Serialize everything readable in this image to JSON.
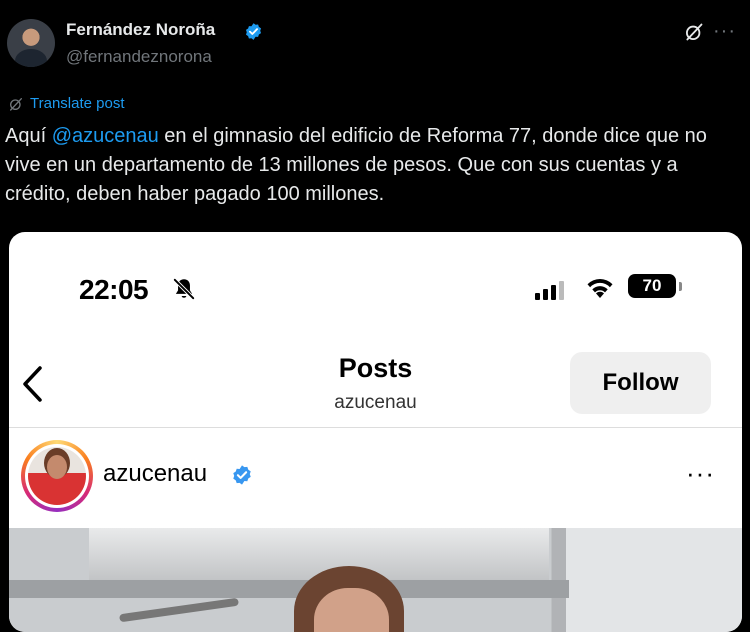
{
  "tweet": {
    "display_name": "Fernández Noroña",
    "handle": "@fernandeznorona",
    "translate_label": "Translate post",
    "more_label": "···",
    "text_before": "Aquí ",
    "mention": "@azucenau",
    "text_after": " en el gimnasio del edificio de Reforma 77, donde dice que no vive en un departamento de 13 millones de pesos. Que con sus cuentas y a crédito, deben haber pagado 100 millones."
  },
  "embedded_screenshot": {
    "status_bar": {
      "time": "22:05",
      "battery": "70"
    },
    "nav": {
      "title": "Posts",
      "subtitle": "azucenau",
      "follow_label": "Follow"
    },
    "post_header": {
      "username": "azucenau",
      "more_label": "···"
    }
  },
  "colors": {
    "link": "#1d9bf0",
    "background": "#000000",
    "muted": "#71767b"
  }
}
